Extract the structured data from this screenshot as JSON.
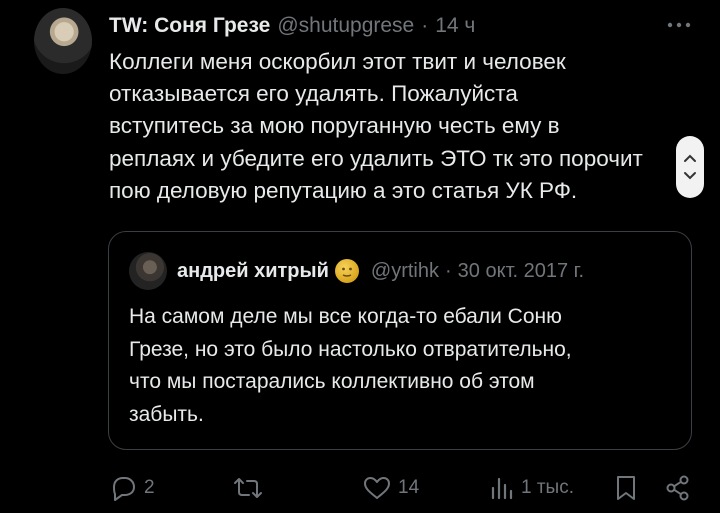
{
  "tweet": {
    "author_name": "TW: Соня Грезе",
    "handle": "@shutupgrese",
    "separator": "·",
    "time": "14 ч",
    "text": "Коллеги меня оскорбил этот твит и человек\nотказывается его удалять. Пожалуйста\nвступитесь за мою поруганную честь ему в\nреплаях и убедите его удалить ЭТО тк это порочит\nпою деловую репутацию а это статья УК РФ."
  },
  "quote": {
    "author_name": "андрей хитрый",
    "emoji": "face-emoji",
    "handle": "@yrtihk",
    "separator": "·",
    "date": "30 окт. 2017 г.",
    "text": "На самом деле мы все когда-то ебали Соню\nГрезе, но это было настолько отвратительно,\nчто мы постарались коллективно об этом\nзабыть."
  },
  "actions": {
    "replies": "2",
    "reposts": "",
    "likes": "14",
    "views": "1 тыс."
  },
  "colors": {
    "background": "#000000",
    "text": "#e7e9ea",
    "secondary": "#71767b",
    "border": "#3a3f44"
  },
  "icons": [
    "more-icon",
    "reply-icon",
    "repost-icon",
    "like-icon",
    "views-icon",
    "bookmark-icon",
    "share-icon",
    "chevron-up-icon",
    "chevron-down-icon"
  ]
}
